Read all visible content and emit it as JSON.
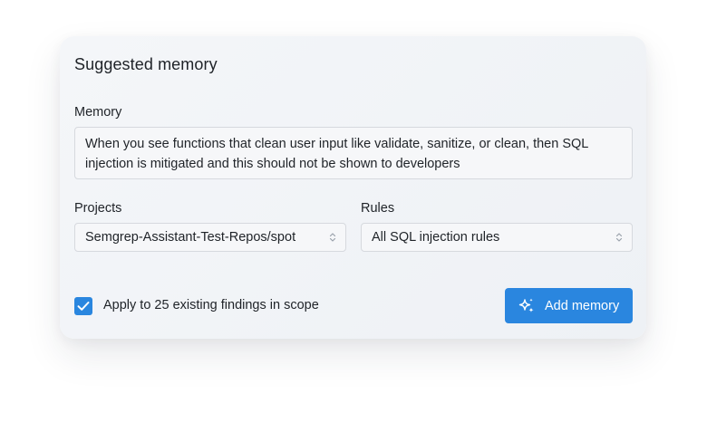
{
  "panel": {
    "title": "Suggested memory"
  },
  "memory": {
    "label": "Memory",
    "value": "When you see functions that clean user input like validate, sanitize, or clean, then SQL injection is mitigated and this should not be shown to developers"
  },
  "projects": {
    "label": "Projects",
    "selected": "Semgrep-Assistant-Test-Repos/spot"
  },
  "rules": {
    "label": "Rules",
    "selected": "All SQL injection rules"
  },
  "apply": {
    "checked": true,
    "label": "Apply to 25 existing findings in scope"
  },
  "actions": {
    "add_label": "Add memory"
  },
  "icons": {
    "select_indicator": "chevron-up-down-icon",
    "add": "sparkles-icon",
    "check": "checkmark-icon"
  },
  "colors": {
    "accent": "#2a86df",
    "text": "#1f2328",
    "field_border": "#d6d9de"
  }
}
